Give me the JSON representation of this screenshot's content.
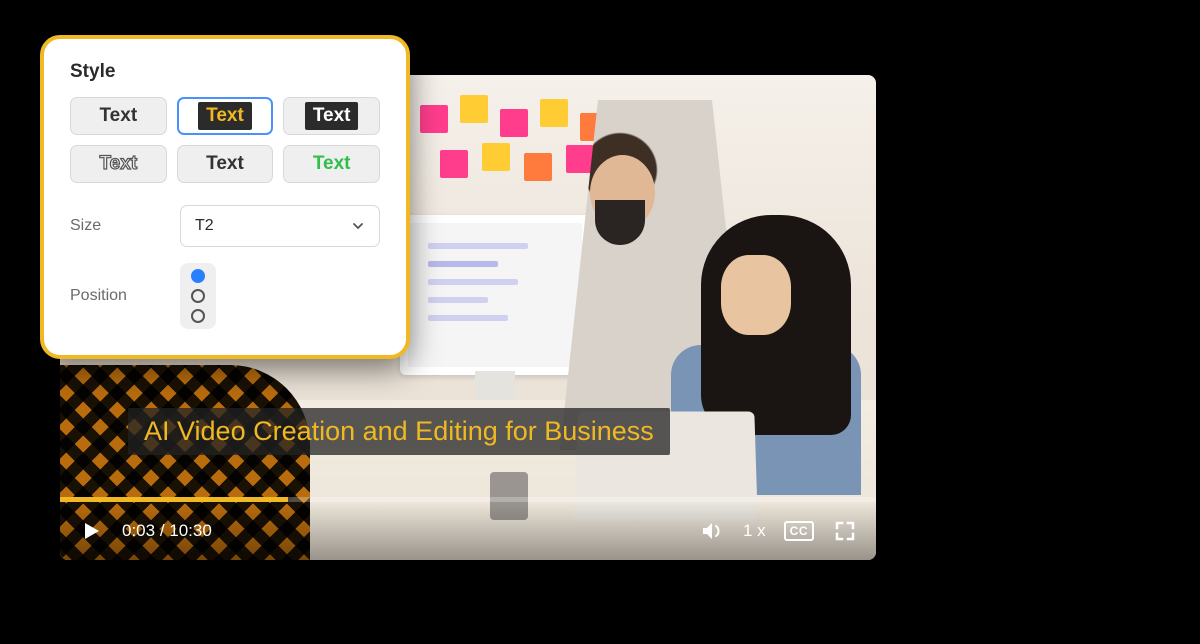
{
  "popup": {
    "title": "Style",
    "styles": [
      {
        "label": "Text"
      },
      {
        "label": "Text"
      },
      {
        "label": "Text"
      },
      {
        "label": "Text"
      },
      {
        "label": "Text"
      },
      {
        "label": "Text"
      }
    ],
    "size_label": "Size",
    "size_value": "T2",
    "position_label": "Position"
  },
  "caption": {
    "text": "AI Video Creation and Editing for Business"
  },
  "player": {
    "current_time": "0:03",
    "duration": "10:30",
    "time_sep": " / ",
    "speed": "1 x",
    "cc_label": "CC",
    "progress_percent": 28
  },
  "colors": {
    "accent": "#f0b823"
  }
}
